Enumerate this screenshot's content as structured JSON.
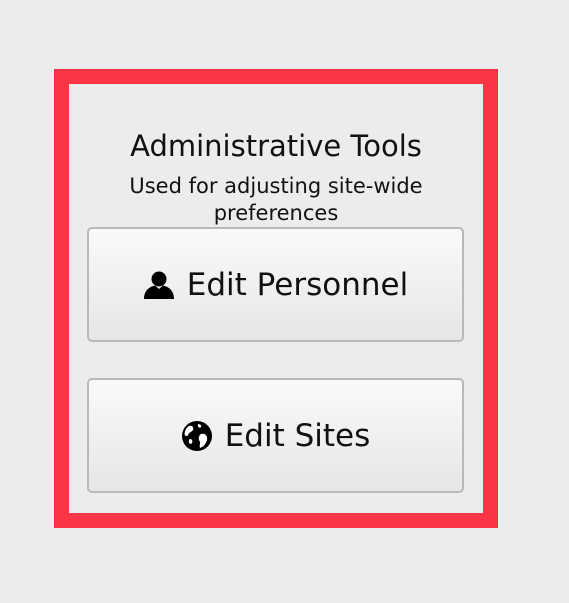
{
  "panel": {
    "title": "Administrative Tools",
    "subtitle": "Used for adjusting site-wide preferences"
  },
  "buttons": [
    {
      "label": "Edit Personnel",
      "icon": "user-icon"
    },
    {
      "label": "Edit Sites",
      "icon": "globe-icon"
    }
  ],
  "colors": {
    "highlight": "#fb3446",
    "background": "#ececec",
    "button_border": "#b9b9b9"
  }
}
